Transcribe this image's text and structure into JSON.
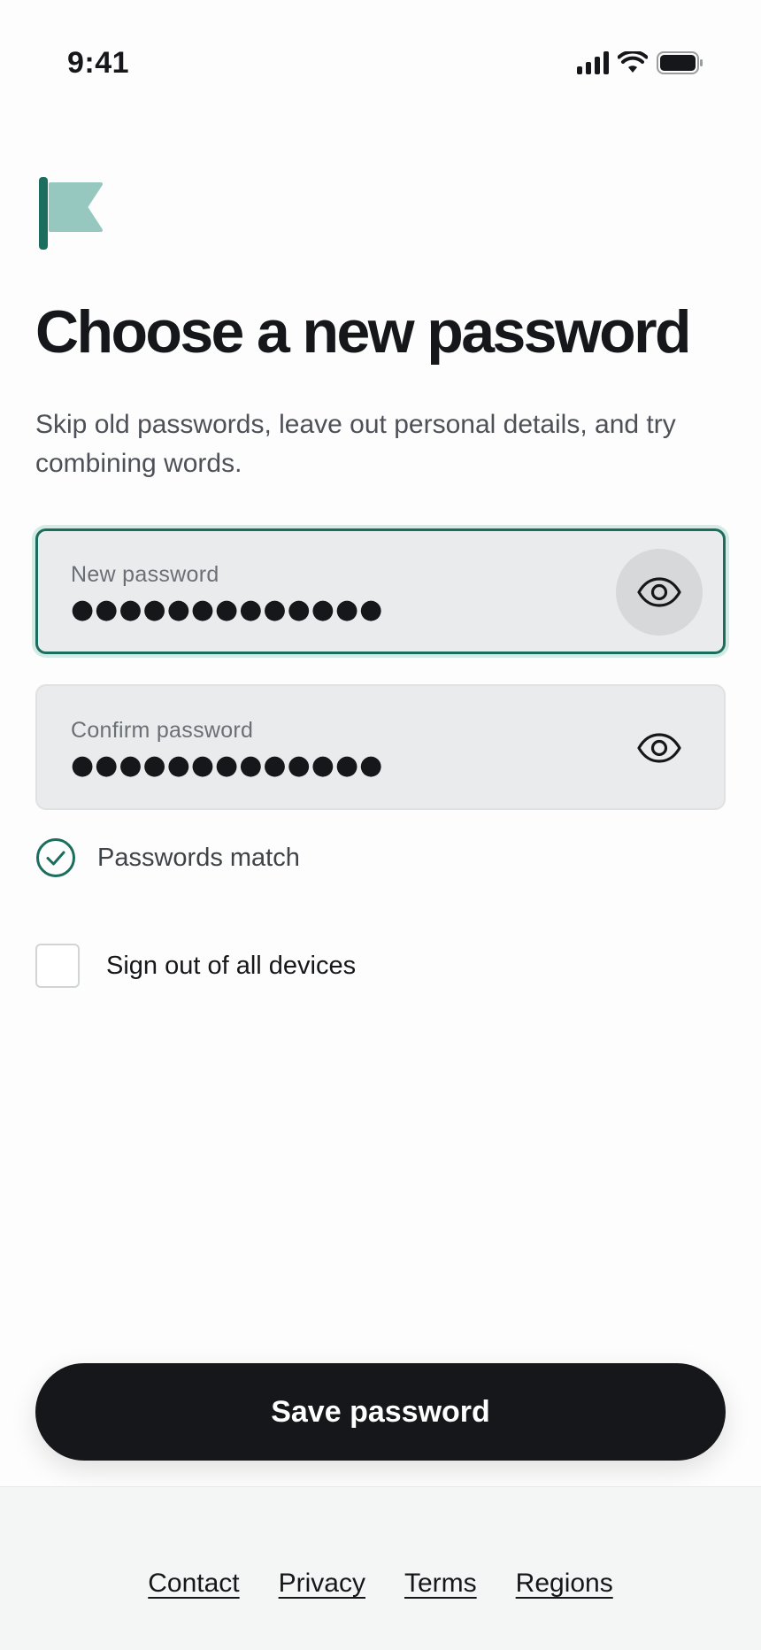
{
  "status_bar": {
    "time": "9:41"
  },
  "header": {
    "title": "Choose a new password",
    "subtitle": "Skip old passwords, leave out personal details, and try combining words."
  },
  "form": {
    "new_password": {
      "label": "New password",
      "value": "●●●●●●●●●●●●●",
      "focused": true,
      "toggle_icon": "eye-icon"
    },
    "confirm_password": {
      "label": "Confirm password",
      "value": "●●●●●●●●●●●●●",
      "focused": false,
      "toggle_icon": "eye-icon"
    },
    "match_hint": "Passwords match",
    "sign_out_all": {
      "label": "Sign out of all devices",
      "checked": false
    },
    "save_label": "Save password"
  },
  "footer": {
    "links": [
      "Contact",
      "Privacy",
      "Terms",
      "Regions"
    ]
  },
  "colors": {
    "accent": "#1b6e5e",
    "logo_light": "#97c8c0",
    "primary_button": "#16171a"
  }
}
